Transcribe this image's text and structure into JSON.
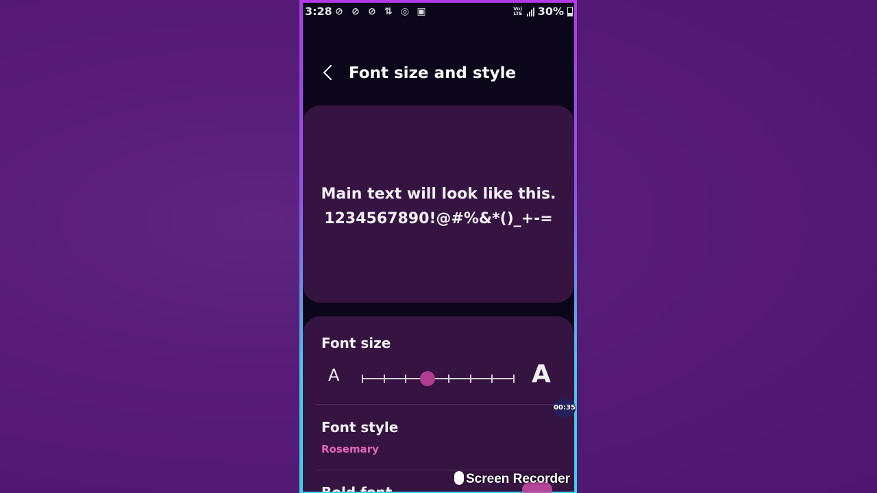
{
  "status_bar": {
    "time": "3:28",
    "network": "VoLTE",
    "battery": "30%",
    "notification_icons": [
      "vpn-icon",
      "vpn-icon",
      "vpn-icon",
      "download-icon",
      "record-icon",
      "image-icon"
    ]
  },
  "header": {
    "back_icon": "chevron-left-icon",
    "title": "Font size and style"
  },
  "preview": {
    "line1": "Main text will look like this.",
    "line2": "1234567890!@#%&*()_+-="
  },
  "font_size": {
    "label": "Font size",
    "small_glyph": "A",
    "large_glyph": "A",
    "steps": 8,
    "selected_step": 3
  },
  "font_style": {
    "label": "Font style",
    "value": "Rosemary",
    "value_color": "#e365b8"
  },
  "bold_font": {
    "label": "Bold font"
  },
  "overlay": {
    "timer": "00:35",
    "recorder_label": "Screen Recorder"
  },
  "colors": {
    "accent": "#b23c92",
    "card_bg": "#361442",
    "screen_bg": "#0b0619"
  }
}
